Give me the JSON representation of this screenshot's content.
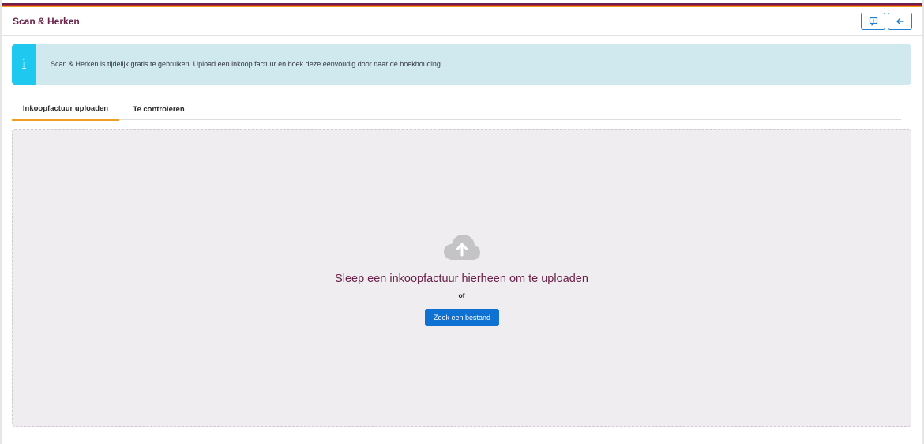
{
  "header": {
    "title": "Scan & Herken",
    "feedback_icon": "feedback-icon",
    "back_icon": "arrow-left-icon",
    "accent_color": "#1f7fd6"
  },
  "info_banner": {
    "icon": "info-icon",
    "icon_glyph": "i",
    "text": "Scan & Herken is tijdelijk gratis te gebruiken. Upload een inkoop factuur en boek deze eenvoudig door naar de boekhouding."
  },
  "tabs": [
    {
      "label": "Inkoopfactuur uploaden",
      "active": true
    },
    {
      "label": "Te controleren",
      "active": false
    }
  ],
  "dropzone": {
    "icon": "cloud-upload-icon",
    "title": "Sleep een inkoopfactuur hierheen om te uploaden",
    "or_text": "of",
    "button_label": "Zoek een bestand"
  },
  "colors": {
    "brand": "#6b2149",
    "tab_underline": "#f0a020",
    "primary_button": "#0f72d2",
    "info_bg": "#d0e9ef",
    "info_icon_bg": "#1ec8ee"
  }
}
